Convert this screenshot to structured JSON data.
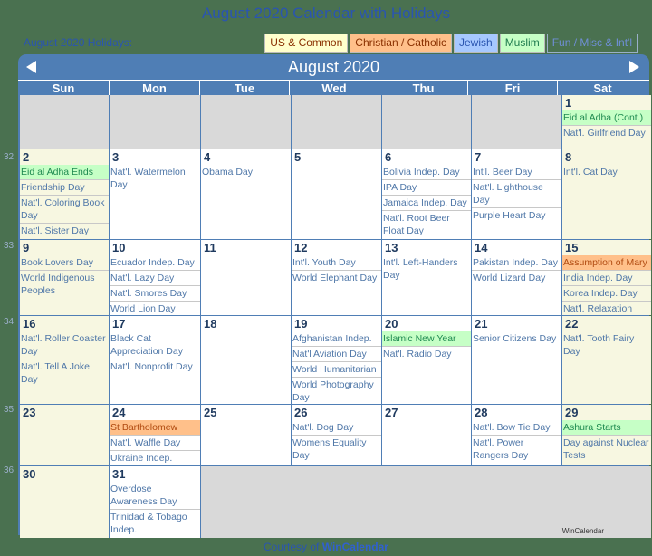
{
  "page_title": "August 2020 Calendar with Holidays",
  "holidays_label": "August 2020 Holidays:",
  "legend": [
    {
      "label": "US & Common",
      "category": "us"
    },
    {
      "label": "Christian / Catholic",
      "category": "christian"
    },
    {
      "label": "Jewish",
      "category": "jewish"
    },
    {
      "label": "Muslim",
      "category": "muslim"
    },
    {
      "label": "Fun / Misc & Int'l",
      "category": "fun"
    }
  ],
  "calendar": {
    "month_title": "August 2020",
    "prev_icon": "triangle-left",
    "next_icon": "triangle-right",
    "weekdays": [
      "Sun",
      "Mon",
      "Tue",
      "Wed",
      "Thu",
      "Fri",
      "Sat"
    ],
    "week_numbers": [
      "32",
      "33",
      "34",
      "35",
      "36"
    ],
    "days": {
      "1": [
        {
          "t": "Eid al Adha (Cont.)",
          "c": "muslim"
        },
        {
          "t": "Nat'l. Girlfriend Day",
          "c": "fun"
        }
      ],
      "2": [
        {
          "t": "Eid al Adha Ends",
          "c": "muslim"
        },
        {
          "t": "Friendship Day",
          "c": "fun"
        },
        {
          "t": "Nat'l. Coloring Book Day",
          "c": "fun"
        },
        {
          "t": "Nat'l. Sister Day",
          "c": "fun"
        }
      ],
      "3": [
        {
          "t": "Nat'l. Watermelon Day",
          "c": "fun"
        }
      ],
      "4": [
        {
          "t": "Obama Day",
          "c": "fun"
        }
      ],
      "5": [],
      "6": [
        {
          "t": "Bolivia Indep. Day",
          "c": "fun"
        },
        {
          "t": "IPA Day",
          "c": "fun"
        },
        {
          "t": "Jamaica Indep. Day",
          "c": "fun"
        },
        {
          "t": "Nat'l. Root Beer Float Day",
          "c": "fun"
        }
      ],
      "7": [
        {
          "t": "Int'l. Beer Day",
          "c": "fun"
        },
        {
          "t": "Nat'l. Lighthouse Day",
          "c": "fun"
        },
        {
          "t": "Purple Heart Day",
          "c": "fun"
        }
      ],
      "8": [
        {
          "t": "Int'l. Cat Day",
          "c": "fun"
        }
      ],
      "9": [
        {
          "t": "Book Lovers Day",
          "c": "fun"
        },
        {
          "t": "World Indigenous Peoples",
          "c": "fun"
        }
      ],
      "10": [
        {
          "t": "Ecuador Indep. Day",
          "c": "fun"
        },
        {
          "t": "Nat'l. Lazy Day",
          "c": "fun"
        },
        {
          "t": "Nat'l. Smores Day",
          "c": "fun"
        },
        {
          "t": "World Lion Day",
          "c": "fun"
        }
      ],
      "11": [],
      "12": [
        {
          "t": "Int'l. Youth Day",
          "c": "fun"
        },
        {
          "t": "World Elephant Day",
          "c": "fun"
        }
      ],
      "13": [
        {
          "t": "Int'l. Left-Handers Day",
          "c": "fun"
        }
      ],
      "14": [
        {
          "t": "Pakistan Indep. Day",
          "c": "fun"
        },
        {
          "t": "World Lizard Day",
          "c": "fun"
        }
      ],
      "15": [
        {
          "t": "Assumption of Mary",
          "c": "christian"
        },
        {
          "t": "India Indep. Day",
          "c": "fun"
        },
        {
          "t": "Korea Indep. Day",
          "c": "fun"
        },
        {
          "t": "Nat'l. Relaxation Day",
          "c": "fun"
        }
      ],
      "16": [
        {
          "t": "Nat'l. Roller Coaster Day",
          "c": "fun"
        },
        {
          "t": "Nat'l. Tell A Joke Day",
          "c": "fun"
        }
      ],
      "17": [
        {
          "t": "Black Cat Appreciation Day",
          "c": "fun"
        },
        {
          "t": "Nat'l. Nonprofit Day",
          "c": "fun"
        }
      ],
      "18": [],
      "19": [
        {
          "t": "Afghanistan Indep.",
          "c": "fun"
        },
        {
          "t": "Nat'l Aviation Day",
          "c": "fun"
        },
        {
          "t": "World Humanitarian",
          "c": "fun"
        },
        {
          "t": "World Photography Day",
          "c": "fun"
        }
      ],
      "20": [
        {
          "t": "Islamic New Year",
          "c": "muslim"
        },
        {
          "t": "Nat'l. Radio Day",
          "c": "fun"
        }
      ],
      "21": [
        {
          "t": "Senior Citizens Day",
          "c": "fun"
        }
      ],
      "22": [
        {
          "t": "Nat'l. Tooth Fairy Day",
          "c": "fun"
        }
      ],
      "23": [],
      "24": [
        {
          "t": "St Bartholomew",
          "c": "christian"
        },
        {
          "t": "Nat'l. Waffle Day",
          "c": "fun"
        },
        {
          "t": "Ukraine Indep.",
          "c": "fun"
        }
      ],
      "25": [],
      "26": [
        {
          "t": "Nat'l. Dog Day",
          "c": "fun"
        },
        {
          "t": "Womens Equality Day",
          "c": "fun"
        }
      ],
      "27": [],
      "28": [
        {
          "t": "Nat'l. Bow Tie Day",
          "c": "fun"
        },
        {
          "t": "Nat'l. Power Rangers Day",
          "c": "fun"
        }
      ],
      "29": [
        {
          "t": "Ashura Starts",
          "c": "muslim"
        },
        {
          "t": "Day against Nuclear Tests",
          "c": "fun"
        }
      ],
      "30": [],
      "31": [
        {
          "t": "Overdose Awareness Day",
          "c": "fun"
        },
        {
          "t": "Trinidad & Tobago Indep.",
          "c": "fun"
        }
      ]
    },
    "first_weekday_index": 6,
    "days_in_month": 31,
    "watermark": "WinCalendar"
  },
  "footer": {
    "prefix": "Courtesy of",
    "link": "WinCalendar"
  }
}
